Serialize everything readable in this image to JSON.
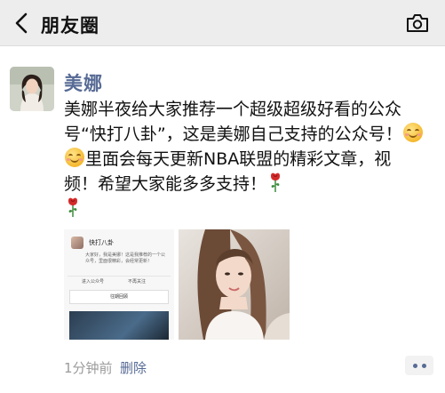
{
  "nav": {
    "title": "朋友圈",
    "back_icon": "chevron-left-icon",
    "camera_icon": "camera-icon"
  },
  "post": {
    "author": "美娜",
    "text_part1": "美娜半夜给大家推荐一个超级超级好看的公众号“快打八卦”，这是美娜自己支持的公众号！",
    "text_part2": "里面会每天更新NBA联盟的精彩文章，视频！希望大家能多多支持！",
    "emojis": [
      "smile-emoji",
      "smile-emoji"
    ],
    "roses": [
      "rose-emoji",
      "rose-emoji"
    ],
    "images": [
      {
        "name": "wechat-account-screenshot",
        "account_name": "快打八卦",
        "description": "大家好，我是美娜！这是我推荐的一个公众号，里面很精彩，会经常更新！",
        "action_left": "进入公众号",
        "action_right": "不再关注",
        "button_label": "往期回顾"
      },
      {
        "name": "selfie-photo"
      }
    ],
    "time": "1分钟前",
    "delete_label": "删除"
  },
  "colors": {
    "link_blue": "#576b95",
    "nav_bg": "#ededed",
    "time_gray": "#9b9b9b"
  }
}
